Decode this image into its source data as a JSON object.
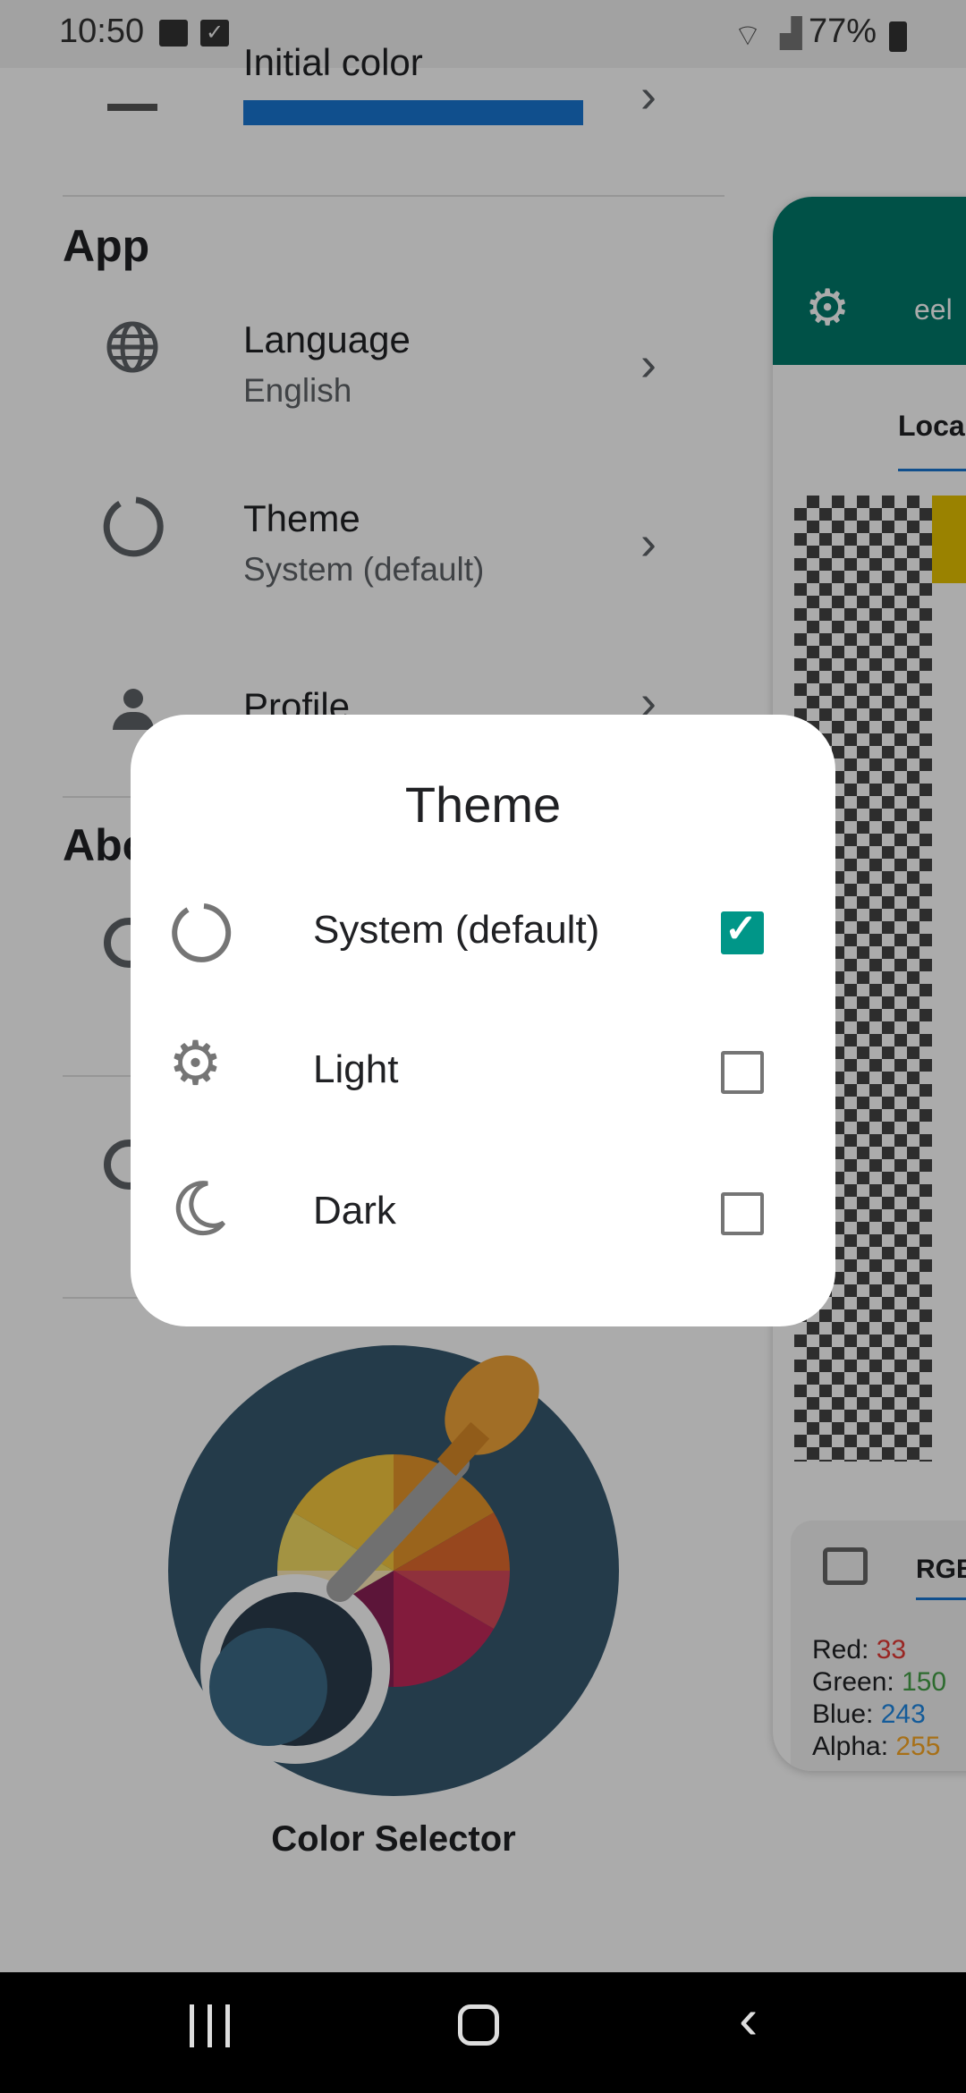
{
  "status_bar": {
    "time": "10:50",
    "battery": "77%"
  },
  "settings": {
    "initial_color_label": "Initial color",
    "initial_color_value": "#2196F3",
    "section_app": "App",
    "items": [
      {
        "title": "Language",
        "subtitle": "English",
        "icon": "globe-icon"
      },
      {
        "title": "Theme",
        "subtitle": "System (default)",
        "icon": "theme-ring-icon"
      },
      {
        "title": "Profile",
        "icon": "person-icon"
      }
    ],
    "section_about": "About"
  },
  "preview": {
    "header_text": "eel",
    "tab_label": "Local",
    "image_tab": "RGB",
    "red_label": "Red:",
    "red_value": "33",
    "green_label": "Green:",
    "green_value": "150",
    "blue_label": "Blue:",
    "blue_value": "243",
    "alpha_label": "Alpha:",
    "alpha_value": "255",
    "accent_color": "#00796B"
  },
  "logo_caption": "Color Selector",
  "dialog": {
    "title": "Theme",
    "options": [
      {
        "label": "System (default)",
        "icon": "system-theme-icon",
        "checked": true
      },
      {
        "label": "Light",
        "icon": "sun-icon",
        "checked": false
      },
      {
        "label": "Dark",
        "icon": "moon-icon",
        "checked": false
      }
    ]
  }
}
